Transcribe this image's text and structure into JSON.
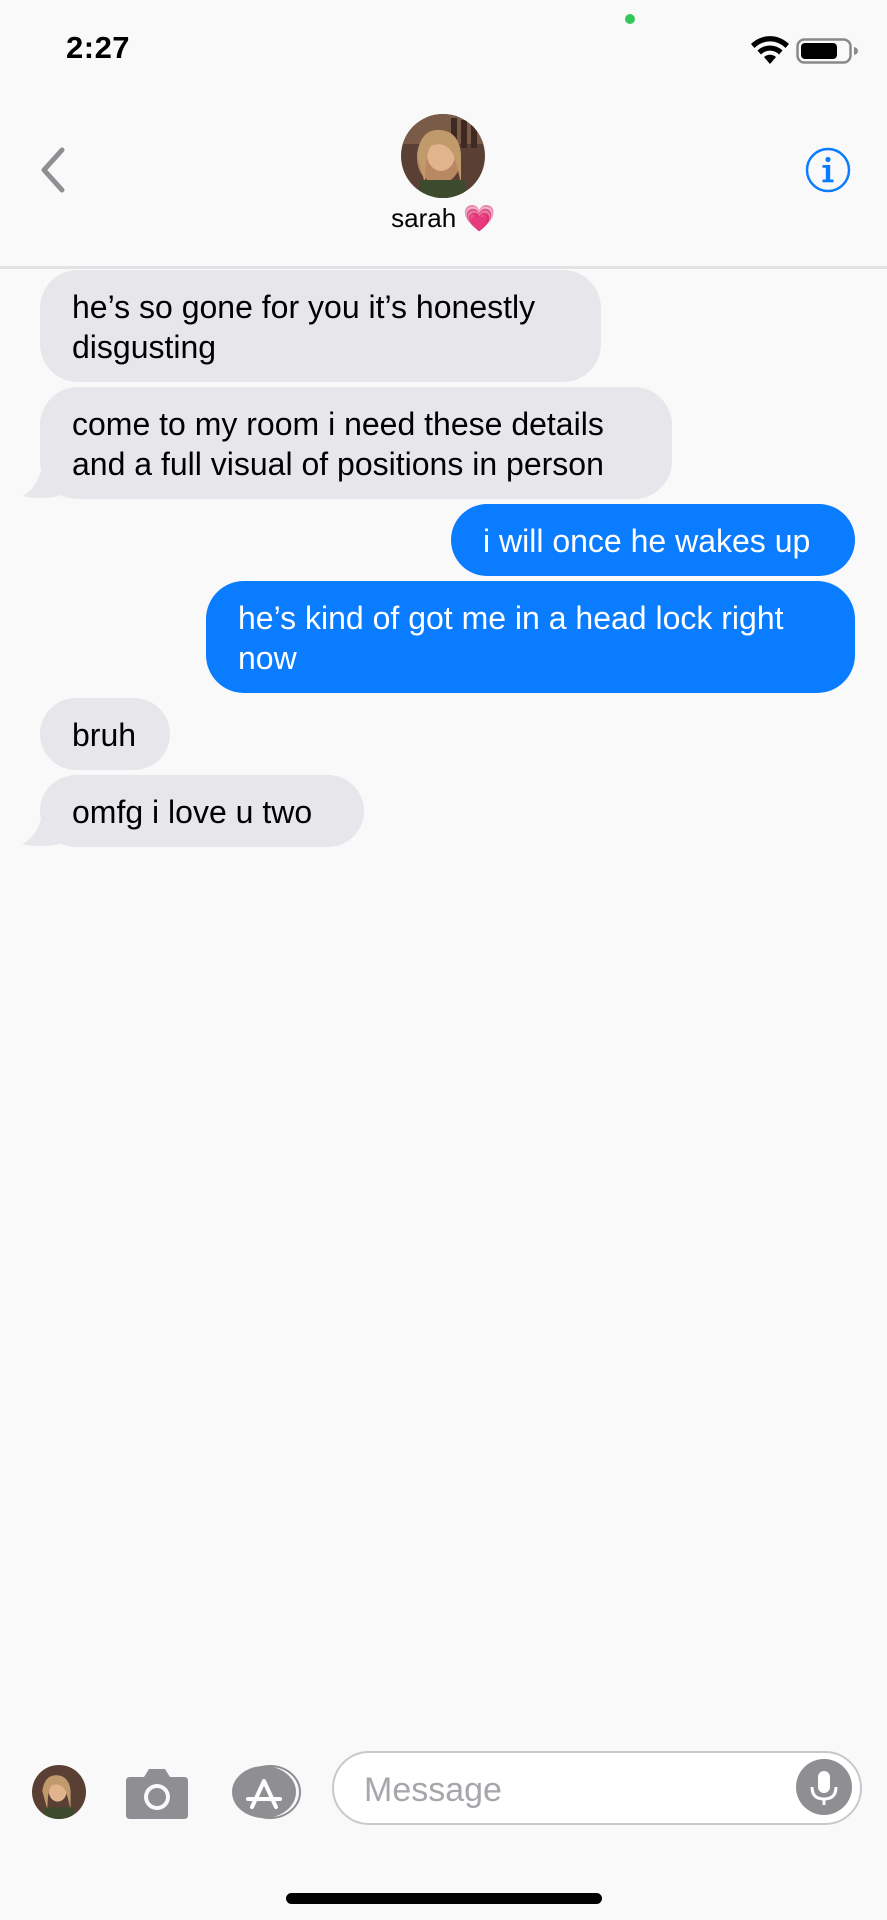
{
  "status_bar": {
    "time": "2:27"
  },
  "header": {
    "contact_name": "sarah 💗"
  },
  "messages": [
    {
      "direction": "received",
      "text_lines": [
        "he’s so gone for you it’s honestly",
        "disgusting"
      ]
    },
    {
      "direction": "received",
      "text_lines": [
        "come to my room i need these details",
        "and a full visual of positions in person"
      ]
    },
    {
      "direction": "sent",
      "text_lines": [
        "i will once he wakes up"
      ]
    },
    {
      "direction": "sent",
      "text_lines": [
        "he’s kind of got me in a head lock right",
        "now"
      ]
    },
    {
      "direction": "received",
      "text_lines": [
        "bruh"
      ]
    },
    {
      "direction": "received",
      "text_lines": [
        "omfg i love u two"
      ]
    }
  ],
  "input": {
    "placeholder": "Message"
  },
  "colors": {
    "sent_bubble": "#0a7cff",
    "received_bubble": "#e7e6eb",
    "accent": "#0a7cff"
  },
  "icons": [
    "back-chevron-icon",
    "info-icon",
    "camera-icon",
    "app-store-icon",
    "microphone-icon",
    "wifi-icon",
    "battery-icon"
  ]
}
